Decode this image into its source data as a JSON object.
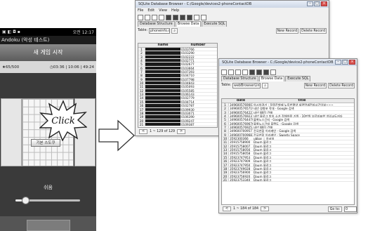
{
  "phone": {
    "status_right": "오전 12:17",
    "app_title": "Andoku (악성 테스트)",
    "header_title": "새 게임 시작",
    "score": "65/500",
    "time": "03:36 | 10:06 | 49:24",
    "popup_button": "기본 스도쿠",
    "level_label": "쉬움",
    "level_value": 0.1
  },
  "click_label": "Click",
  "window1": {
    "title": "SQLite Database Browser - C:/Google/devices2-phoneContactDB",
    "menu": [
      "File",
      "Edit",
      "View",
      "Help"
    ],
    "tabs": [
      "Database Structure",
      "Browse Data",
      "Execute SQL"
    ],
    "table_label": "Table:",
    "table_select": "phoneinfo.db",
    "new_record": "New Record",
    "delete_record": "Delete Record",
    "columns": [
      "name",
      "number"
    ],
    "rows": [
      {
        "n": "1",
        "name": "",
        "number": "0103766"
      },
      {
        "n": "2",
        "name": "",
        "number": "0103290"
      },
      {
        "n": "3",
        "name": "",
        "number": "0102222"
      },
      {
        "n": "4",
        "name": "",
        "number": "0102771"
      },
      {
        "n": "5",
        "name": "",
        "number": "0102677"
      },
      {
        "n": "6",
        "name": "",
        "number": "0103664"
      },
      {
        "n": "7",
        "name": "",
        "number": "0107393"
      },
      {
        "n": "8",
        "name": "",
        "number": "0104710"
      },
      {
        "n": "9",
        "name": "",
        "number": "0107798"
      },
      {
        "n": "10",
        "name": "",
        "number": "0104843"
      },
      {
        "n": "11",
        "name": "",
        "number": "0105093"
      },
      {
        "n": "12",
        "name": "",
        "number": "0105585"
      },
      {
        "n": "13",
        "name": "",
        "number": "0106143"
      },
      {
        "n": "14",
        "name": "",
        "number": "0102779"
      },
      {
        "n": "15",
        "name": "",
        "number": "0104714"
      },
      {
        "n": "16",
        "name": "",
        "number": "0102787"
      },
      {
        "n": "17",
        "name": "",
        "number": "0109930"
      },
      {
        "n": "18",
        "name": "",
        "number": "0103071"
      },
      {
        "n": "19",
        "name": "",
        "number": "0106390"
      },
      {
        "n": "20",
        "name": "",
        "number": "0109247"
      },
      {
        "n": "21",
        "name": "",
        "number": "0109387"
      }
    ],
    "footer_text": "1 ~ 129 of 129"
  },
  "window2": {
    "title": "SQLite Database Browser - C:/Google/device2-phoneContactDB",
    "tabs": [
      "Database Structure",
      "Browse Data",
      "Execute SQL"
    ],
    "table_label": "Table:",
    "table_select": "webBrowserLinks.db",
    "new_record": "New Record",
    "delete_record": "Delete Record",
    "columns": [
      "date",
      "title"
    ],
    "rows": [
      {
        "n": "1",
        "date": "3496005769003",
        "title": "아시아경기 : 정몽준형제 노동한평양 세관면세전자시간이보~~~"
      },
      {
        "n": "2",
        "date": "3496005765719",
        "title": "네년 경향포 작대 - Google 검색"
      },
      {
        "n": "3",
        "date": "3496005764223",
        "title": "네년 WIFI 건해"
      },
      {
        "n": "4",
        "date": "3496005769237",
        "title": "네년 블로그 방송 소가 정체허용 기원 - 10만원 부르지표한 치임교도지다"
      },
      {
        "n": "5",
        "date": "3496005764470",
        "title": "블록노스긴지 - Google 검색"
      },
      {
        "n": "6",
        "date": "3496005769676",
        "title": "블록노스긴데 플랜도 - Google 검색"
      },
      {
        "n": "7",
        "date": "3496005769253",
        "title": "네년 WIFI 건해"
      },
      {
        "n": "8",
        "date": "3496007009577",
        "title": "전국연합 이라캐인 - Google 검색"
      },
      {
        "n": "9",
        "date": "3496007009683",
        "title": "전국연합 이라캐인 - Sweety Space"
      },
      {
        "n": "10",
        "date": "3592300366",
        "title": "ubbar :: 차서처"
      },
      {
        "n": "11",
        "date": "35915758900",
        "title": "Daum 블로그"
      },
      {
        "n": "12",
        "date": "35915758007",
        "title": "Daum 블로그"
      },
      {
        "n": "13",
        "date": "35915758056",
        "title": "Daum 블로그"
      },
      {
        "n": "14",
        "date": "35915758058",
        "title": "Daum 블로그"
      },
      {
        "n": "15",
        "date": "35923747953",
        "title": "Daum 블로그"
      },
      {
        "n": "16",
        "date": "35923747909",
        "title": "Daum 블로그"
      },
      {
        "n": "17",
        "date": "35923747950",
        "title": "Daum 블로그"
      },
      {
        "n": "18",
        "date": "35923749028",
        "title": "Daum 블로그"
      },
      {
        "n": "19",
        "date": "35923756900",
        "title": "Daum 블로그"
      },
      {
        "n": "20",
        "date": "35923756920",
        "title": "Daum 블로그"
      },
      {
        "n": "21",
        "date": "35923753340",
        "title": "Daum 블로그"
      }
    ],
    "footer_text": "1 ~ 184 of 184",
    "goto_label": "Go to:",
    "goto_value": "0"
  }
}
